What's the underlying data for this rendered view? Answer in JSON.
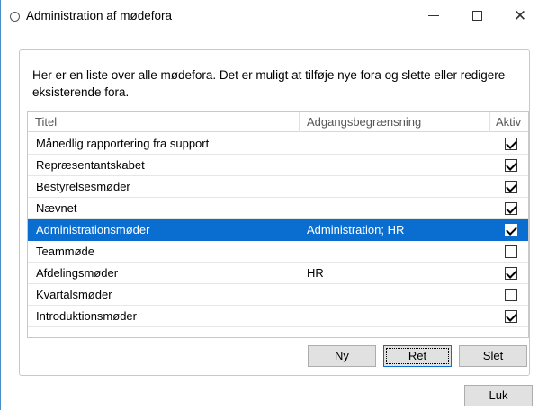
{
  "window": {
    "title": "Administration af mødefora"
  },
  "intro_text": "Her er en liste over alle mødefora. Det er muligt at tilføje nye fora og slette eller redigere eksisterende fora.",
  "table": {
    "columns": [
      "Titel",
      "Adgangsbegrænsning",
      "Aktiv"
    ],
    "rows": [
      {
        "titel": "Månedlig rapportering fra support",
        "adgang": "",
        "aktiv": true,
        "selected": false
      },
      {
        "titel": "Repræsentantskabet",
        "adgang": "",
        "aktiv": true,
        "selected": false
      },
      {
        "titel": "Bestyrelsesmøder",
        "adgang": "",
        "aktiv": true,
        "selected": false
      },
      {
        "titel": "Nævnet",
        "adgang": "",
        "aktiv": true,
        "selected": false
      },
      {
        "titel": "Administrationsmøder",
        "adgang": "Administration; HR",
        "aktiv": true,
        "selected": true
      },
      {
        "titel": "Teammøde",
        "adgang": "",
        "aktiv": false,
        "selected": false
      },
      {
        "titel": "Afdelingsmøder",
        "adgang": "HR",
        "aktiv": true,
        "selected": false
      },
      {
        "titel": "Kvartalsmøder",
        "adgang": "",
        "aktiv": false,
        "selected": false
      },
      {
        "titel": "Introduktionsmøder",
        "adgang": "",
        "aktiv": true,
        "selected": false
      }
    ]
  },
  "buttons": {
    "ny": "Ny",
    "ret": "Ret",
    "slet": "Slet",
    "luk": "Luk"
  },
  "colors": {
    "selection": "#0a6ed1",
    "button_face": "#e1e1e1"
  }
}
